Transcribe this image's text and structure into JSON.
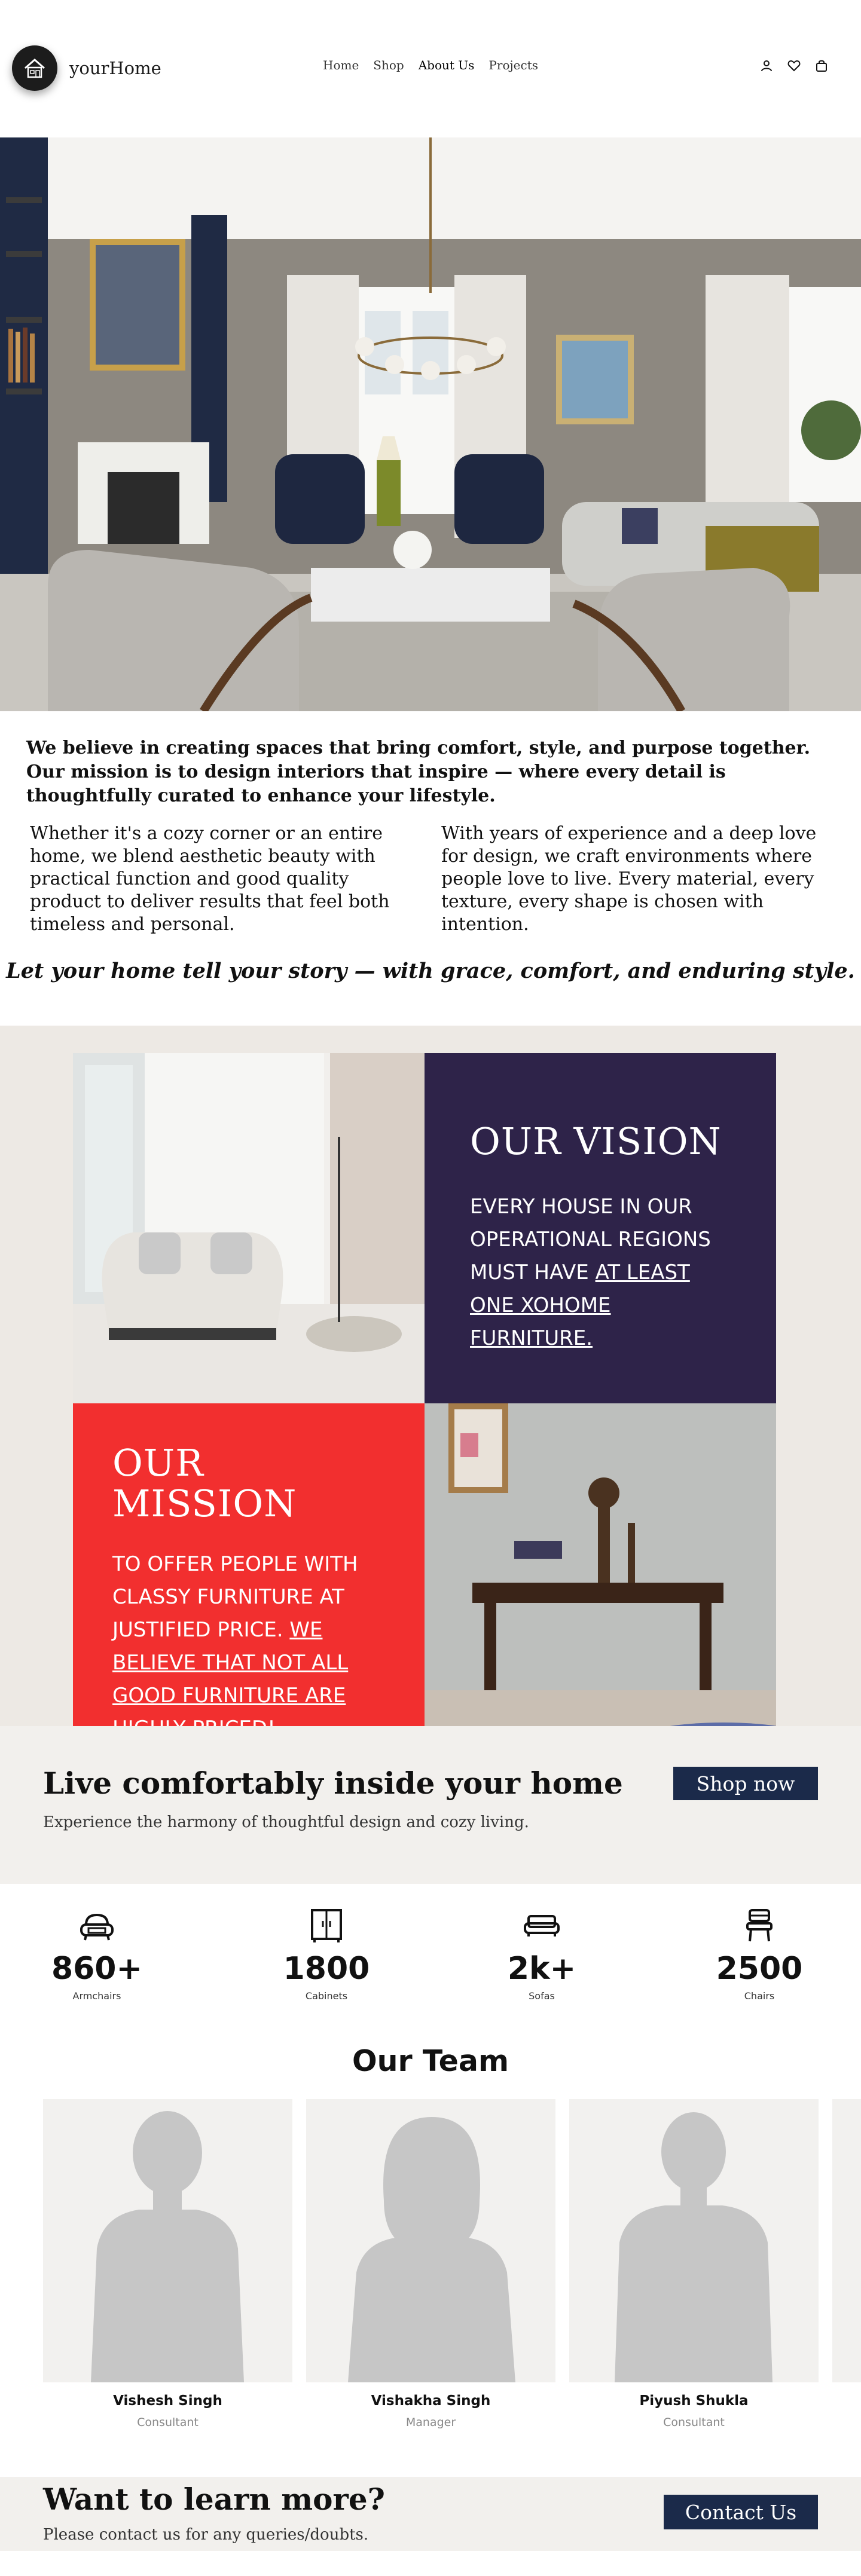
{
  "brand": {
    "name": "yourHome"
  },
  "nav": {
    "items": [
      {
        "label": "Home"
      },
      {
        "label": "Shop"
      },
      {
        "label": "About Us"
      },
      {
        "label": "Projects"
      }
    ],
    "icons": [
      "user-icon",
      "wishlist-heart-icon",
      "cart-bag-icon"
    ]
  },
  "about": {
    "lead": "We believe in creating spaces that bring comfort, style, and purpose together. Our mission is to design interiors that inspire — where every detail is thoughtfully curated to enhance your lifestyle.",
    "col1": "Whether it's a cozy corner or an entire home, we blend aesthetic beauty with practical function and good quality product to deliver results that feel both timeless and personal.",
    "col2": "With years of experience and a deep love for design, we craft environments where people love to live. Every material, every texture, every shape is chosen with intention.",
    "tagline": "Let your home tell your story — with grace, comfort, and enduring style."
  },
  "vision": {
    "title": "OUR VISION",
    "text": "EVERY HOUSE IN OUR OPERATIONAL REGIONS MUST HAVE ",
    "underlined": "AT LEAST ONE XOHOME FURNITURE."
  },
  "mission": {
    "title": "OUR MISSION",
    "text": "TO OFFER PEOPLE WITH CLASSY FURNITURE AT JUSTIFIED PRICE.",
    "underlined": "WE BELIEVE THAT NOT ALL GOOD FURNITURE ARE HIGHLY PRICED!"
  },
  "cta": {
    "title": "Live comfortably inside your home",
    "subtitle": "Experience the harmony of thoughtful design and cozy living.",
    "button": "Shop now"
  },
  "stats": [
    {
      "value": "860+",
      "label": "Armchairs",
      "icon": "armchair-icon"
    },
    {
      "value": "1800",
      "label": "Cabinets",
      "icon": "cabinet-icon"
    },
    {
      "value": "2k+",
      "label": "Sofas",
      "icon": "sofa-icon"
    },
    {
      "value": "2500",
      "label": "Chairs",
      "icon": "chair-icon"
    }
  ],
  "team": {
    "title": "Our Team",
    "members": [
      {
        "name": "Vishesh Singh",
        "role": "Consultant"
      },
      {
        "name": "Vishakha Singh",
        "role": "Manager"
      },
      {
        "name": "Piyush Shukla",
        "role": "Consultant"
      }
    ]
  },
  "learn": {
    "title": "Want to learn more?",
    "subtitle": "Please contact us for any queries/doubts.",
    "button": "Contact Us"
  },
  "colors": {
    "navy": "#1b2a4a",
    "vision_panel": "#2e2349",
    "mission_panel": "#f22f2f",
    "beige": "#ede9e4"
  }
}
